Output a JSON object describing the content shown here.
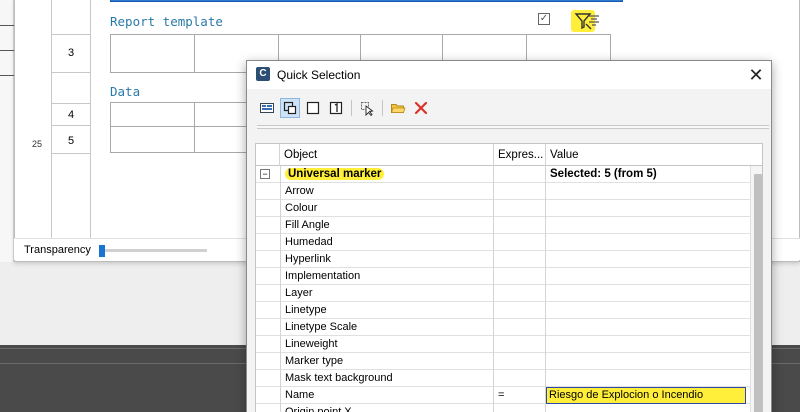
{
  "report_editor": {
    "section_report_template": "Report template",
    "section_data": "Data",
    "row_numbers": [
      "3",
      "4",
      "5"
    ],
    "ruler_label": "25",
    "transparency_label": "Transparency",
    "transparency_value_percent": 0
  },
  "quick_selection": {
    "title": "Quick Selection",
    "app_icon_letter": "C",
    "close_glyph": "✕",
    "columns": {
      "object": "Object",
      "expression": "Expres...",
      "value": "Value"
    },
    "group": {
      "toggle": "−",
      "object": "Universal marker",
      "value": "Selected: 5 (from 5)"
    },
    "properties": [
      {
        "object": "Arrow",
        "expression": "",
        "value": ""
      },
      {
        "object": "Colour",
        "expression": "",
        "value": ""
      },
      {
        "object": "Fill Angle",
        "expression": "",
        "value": ""
      },
      {
        "object": "Humedad",
        "expression": "",
        "value": ""
      },
      {
        "object": "Hyperlink",
        "expression": "",
        "value": ""
      },
      {
        "object": "Implementation",
        "expression": "",
        "value": ""
      },
      {
        "object": "Layer",
        "expression": "",
        "value": ""
      },
      {
        "object": "Linetype",
        "expression": "",
        "value": ""
      },
      {
        "object": "Linetype Scale",
        "expression": "",
        "value": ""
      },
      {
        "object": "Lineweight",
        "expression": "",
        "value": ""
      },
      {
        "object": "Marker type",
        "expression": "",
        "value": ""
      },
      {
        "object": "Mask text background",
        "expression": "",
        "value": ""
      }
    ],
    "name_row": {
      "object": "Name",
      "expression": "=",
      "value": "Riesgo de Explocion o Incendio"
    },
    "partial_row": {
      "object": "Origin point X",
      "expression": "",
      "value": ""
    }
  },
  "colors": {
    "highlight": "#ffef3a",
    "accent_blue": "#1874d1",
    "section_title": "#2a7aa8",
    "delete_red": "#d9332b"
  }
}
